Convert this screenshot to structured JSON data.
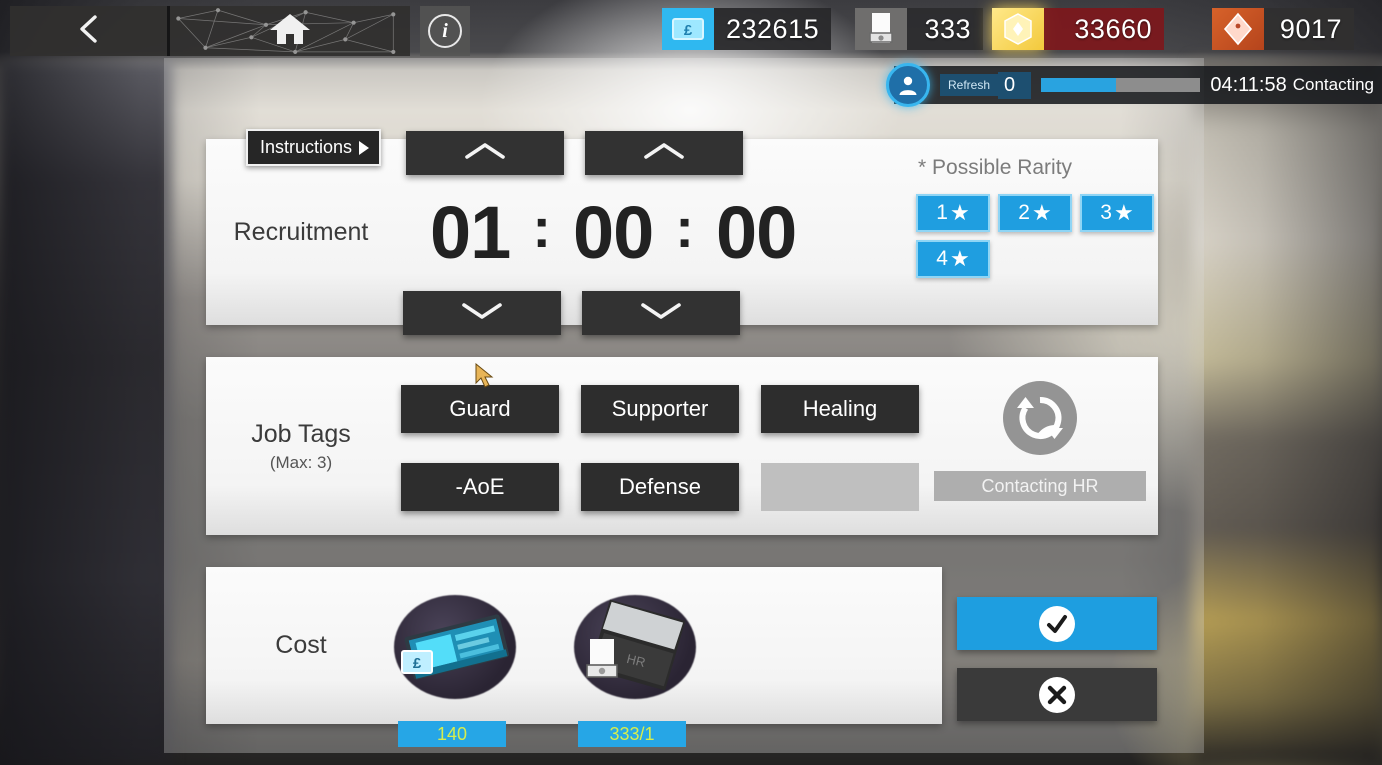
{
  "topbar": {
    "back_label": "back",
    "home_label": "home",
    "info_label": "i",
    "currencies": [
      {
        "name": "lmd",
        "icon": "lmd-icon",
        "value": "232615"
      },
      {
        "name": "recruit-permit",
        "icon": "recruit-permit-icon",
        "value": "333"
      },
      {
        "name": "orundum",
        "icon": "orundum-icon",
        "value": "33660"
      },
      {
        "name": "originite",
        "icon": "originite-icon",
        "value": "9017"
      }
    ]
  },
  "refresh_bar": {
    "label": "Refresh",
    "count": "0",
    "progress_percent": 47,
    "time": "04:11:58",
    "status": "Contacting"
  },
  "instructions": {
    "label": "Instructions"
  },
  "recruitment": {
    "label": "Recruitment",
    "hours": "01",
    "minutes": "00",
    "seconds": "00",
    "separator": ":",
    "rarity_title": "* Possible Rarity",
    "rarity_tags": [
      "1",
      "2",
      "3",
      "4"
    ],
    "star_glyph": "★",
    "up_arrow": "chevron-up",
    "down_arrow": "chevron-down"
  },
  "job_tags": {
    "label": "Job Tags",
    "sublabel": "(Max: 3)",
    "tags": [
      "Guard",
      "Supporter",
      "Healing",
      "-AoE",
      "Defense",
      ""
    ],
    "hr_button_label": "Contacting HR",
    "refresh_icon": "refresh-icon"
  },
  "cost": {
    "label": "Cost",
    "items": [
      {
        "name": "lmd-cost",
        "value": "140"
      },
      {
        "name": "permit-cost",
        "value": "333/1"
      }
    ]
  },
  "actions": {
    "confirm_icon": "check-icon",
    "cancel_icon": "close-icon"
  },
  "colors": {
    "accent_blue": "#1e9ee0",
    "tag_dark": "#2d2d2d",
    "badge_green": "#d6ee4e",
    "panel_white": "#f4f4f4"
  }
}
